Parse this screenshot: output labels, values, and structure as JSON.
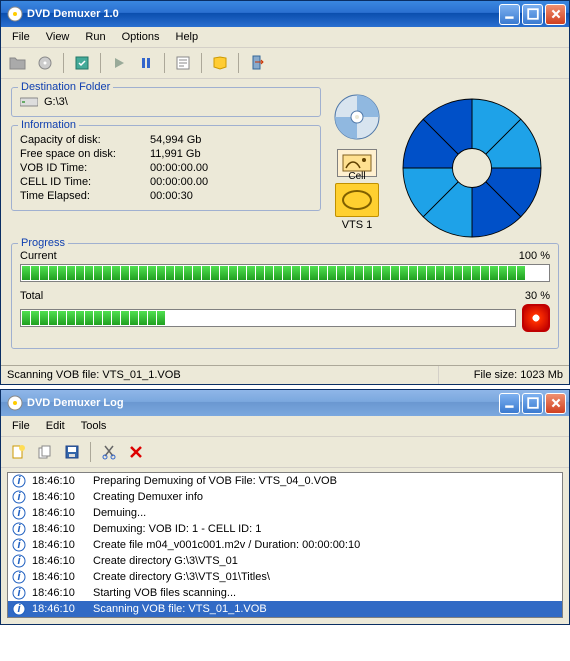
{
  "main": {
    "title": "DVD Demuxer 1.0",
    "menus": [
      "File",
      "View",
      "Run",
      "Options",
      "Help"
    ],
    "destination": {
      "legend": "Destination Folder",
      "path": "G:\\3\\"
    },
    "info": {
      "legend": "Information",
      "rows": [
        {
          "label": "Capacity of disk:",
          "value": "54,994 Gb"
        },
        {
          "label": "Free space on disk:",
          "value": "11,991 Gb"
        },
        {
          "label": "VOB ID Time:",
          "value": "00:00:00.00"
        },
        {
          "label": "CELL ID Time:",
          "value": "00:00:00.00"
        },
        {
          "label": "Time Elapsed:",
          "value": "00:00:30"
        }
      ]
    },
    "cell_label": "Cell",
    "vts_label": "VTS 1",
    "progress": {
      "legend": "Progress",
      "current_label": "Current",
      "current_pct": "100 %",
      "total_label": "Total",
      "total_pct": "30 %"
    },
    "status": {
      "left": "Scanning VOB file: VTS_01_1.VOB",
      "right": "File size: 1023 Mb"
    }
  },
  "chart_data": {
    "type": "pie",
    "title": "",
    "slices": [
      {
        "color": "#1ea2e8",
        "value": 12.5
      },
      {
        "color": "#1ea2e8",
        "value": 12.5
      },
      {
        "color": "#0050c8",
        "value": 12.5
      },
      {
        "color": "#0050c8",
        "value": 12.5
      },
      {
        "color": "#1ea2e8",
        "value": 12.5
      },
      {
        "color": "#1ea2e8",
        "value": 12.5
      },
      {
        "color": "#0050c8",
        "value": 12.5
      },
      {
        "color": "#0050c8",
        "value": 12.5
      }
    ]
  },
  "log": {
    "title": "DVD Demuxer Log",
    "menus": [
      "File",
      "Edit",
      "Tools"
    ],
    "entries": [
      {
        "time": "18:46:10",
        "msg": "Preparing Demuxing of VOB File: VTS_04_0.VOB"
      },
      {
        "time": "18:46:10",
        "msg": "Creating Demuxer info"
      },
      {
        "time": "18:46:10",
        "msg": "Demuing..."
      },
      {
        "time": "18:46:10",
        "msg": "Demuxing: VOB ID: 1 - CELL ID: 1"
      },
      {
        "time": "18:46:10",
        "msg": "Create file m04_v001c001.m2v / Duration: 00:00:00:10"
      },
      {
        "time": "18:46:10",
        "msg": "Create directory G:\\3\\VTS_01"
      },
      {
        "time": "18:46:10",
        "msg": "Create directory G:\\3\\VTS_01\\Titles\\"
      },
      {
        "time": "18:46:10",
        "msg": "Starting VOB files scanning..."
      },
      {
        "time": "18:46:10",
        "msg": "Scanning VOB file: VTS_01_1.VOB",
        "selected": true
      }
    ]
  }
}
